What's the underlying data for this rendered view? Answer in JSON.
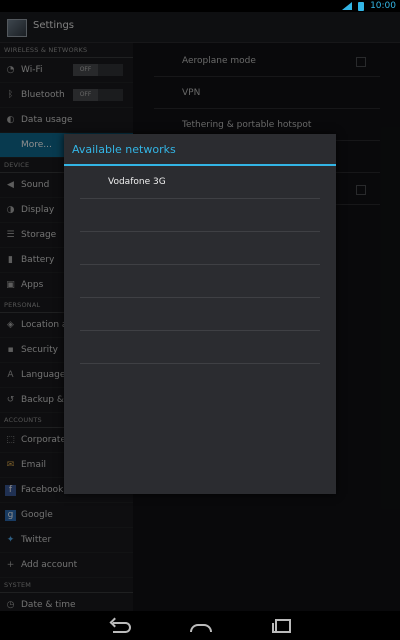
{
  "status": {
    "time": "10:00"
  },
  "app": {
    "title": "Settings"
  },
  "sidebar": {
    "wireless_header": "WIRELESS & NETWORKS",
    "wifi": "Wi-Fi",
    "wifi_toggle": "OFF",
    "bluetooth": "Bluetooth",
    "bluetooth_toggle": "OFF",
    "data_usage": "Data usage",
    "more": "More...",
    "device_header": "DEVICE",
    "sound": "Sound",
    "display": "Display",
    "storage": "Storage",
    "battery": "Battery",
    "apps": "Apps",
    "personal_header": "PERSONAL",
    "location": "Location a",
    "security": "Security",
    "language": "Language",
    "backup": "Backup & r",
    "accounts_header": "ACCOUNTS",
    "corporate": "Corporate",
    "email": "Email",
    "facebook": "Facebook",
    "google": "Google",
    "twitter": "Twitter",
    "add_account": "Add account",
    "system_header": "SYSTEM",
    "date_time": "Date & time"
  },
  "detail": {
    "aeroplane": "Aeroplane mode",
    "vpn": "VPN",
    "tethering": "Tethering & portable hotspot"
  },
  "dialog": {
    "title": "Available networks",
    "networks": [
      "Vodafone 3G",
      "",
      "",
      "",
      "",
      "",
      ""
    ]
  }
}
